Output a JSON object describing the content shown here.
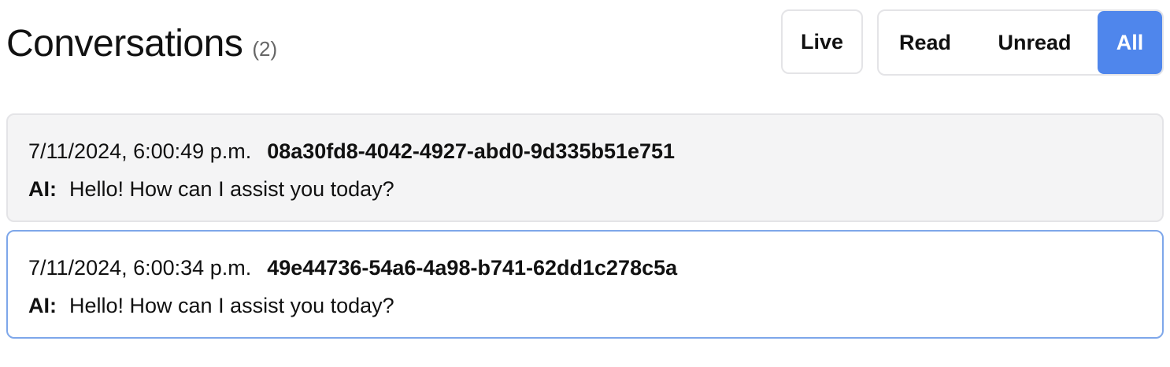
{
  "header": {
    "title": "Conversations",
    "count": "(2)"
  },
  "filters": {
    "live_label": "Live",
    "read_label": "Read",
    "unread_label": "Unread",
    "all_label": "All",
    "selected": "All"
  },
  "colors": {
    "accent": "#4f86ec",
    "selected_card_border": "#7ea7ea",
    "card_bg": "#f4f4f5"
  },
  "conversations": [
    {
      "timestamp": "7/11/2024, 6:00:49 p.m.",
      "id": "08a30fd8-4042-4927-abd0-9d335b51e751",
      "speaker": "AI:",
      "message": "Hello! How can I assist you today?"
    },
    {
      "timestamp": "7/11/2024, 6:00:34 p.m.",
      "id": "49e44736-54a6-4a98-b741-62dd1c278c5a",
      "speaker": "AI:",
      "message": "Hello! How can I assist you today?"
    }
  ]
}
